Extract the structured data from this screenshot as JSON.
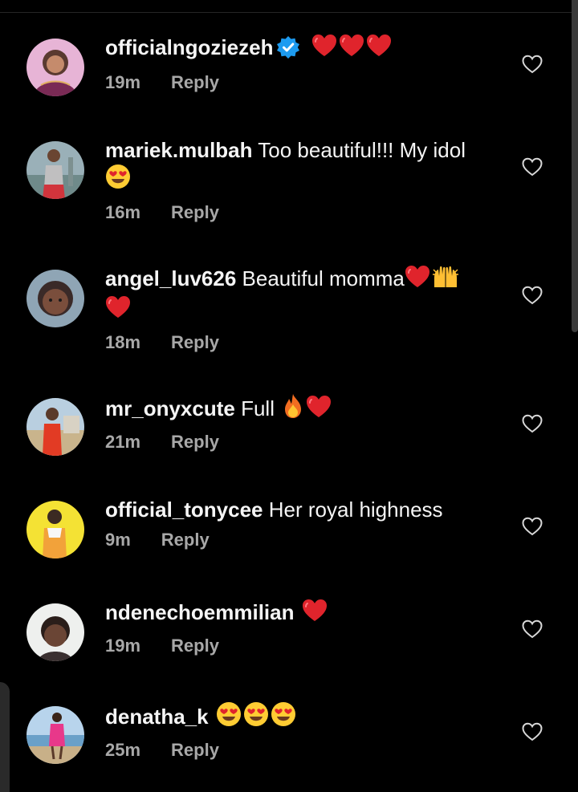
{
  "comments": [
    {
      "username": "officialngoziezeh",
      "verified": true,
      "text": "",
      "emojis": [
        "heart",
        "heart",
        "heart"
      ],
      "time": "19m",
      "reply_label": "Reply"
    },
    {
      "username": "mariek.mulbah",
      "verified": false,
      "text": "Too beautiful!!! My idol",
      "emojis": [
        "heart-eyes"
      ],
      "time": "16m",
      "reply_label": "Reply"
    },
    {
      "username": "angel_luv626",
      "verified": false,
      "text": "Beautiful momma",
      "emojis": [
        "heart",
        "raised-hands",
        "heart"
      ],
      "time": "18m",
      "reply_label": "Reply"
    },
    {
      "username": "mr_onyxcute",
      "verified": false,
      "text": "Full ",
      "emojis": [
        "fire",
        "heart"
      ],
      "time": "21m",
      "reply_label": "Reply"
    },
    {
      "username": "official_tonycee",
      "verified": false,
      "text": "Her royal highness",
      "emojis": [],
      "time": "9m",
      "reply_label": "Reply"
    },
    {
      "username": "ndenechoemmilian",
      "verified": false,
      "text": "",
      "emojis": [
        "heart"
      ],
      "time": "19m",
      "reply_label": "Reply"
    },
    {
      "username": "denatha_k",
      "verified": false,
      "text": "",
      "emojis": [
        "heart-eyes",
        "heart-eyes",
        "heart-eyes"
      ],
      "time": "25m",
      "reply_label": "Reply"
    }
  ],
  "colors": {
    "background": "#000000",
    "username": "#f5f5f5",
    "meta": "#a8a8a8",
    "heart_emoji": "#e0242c",
    "verified": "#1d9bf0"
  }
}
